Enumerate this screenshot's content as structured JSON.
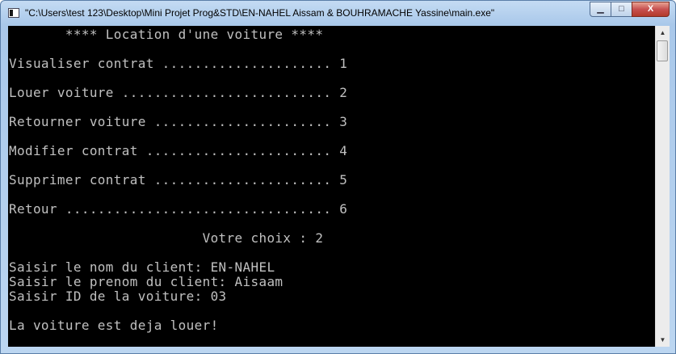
{
  "window": {
    "title": "\"C:\\Users\\test 123\\Desktop\\Mini Projet Prog&STD\\EN-NAHEL Aissam & BOUHRAMACHE Yassine\\main.exe\"",
    "minimize_label": "▁",
    "maximize_label": "□",
    "close_label": "X"
  },
  "console": {
    "lines": [
      "       **** Location d'une voiture ****",
      "",
      "Visualiser contrat ..................... 1",
      "",
      "Louer voiture .......................... 2",
      "",
      "Retourner voiture ...................... 3",
      "",
      "Modifier contrat ....................... 4",
      "",
      "Supprimer contrat ...................... 5",
      "",
      "Retour ................................. 6",
      "",
      "                        Votre choix : 2",
      "",
      "Saisir le nom du client: EN-NAHEL",
      "Saisir le prenom du client: Aisaam",
      "Saisir ID de la voiture: 03",
      "",
      "La voiture est deja louer!"
    ]
  },
  "scrollbar": {
    "up_arrow": "▲",
    "down_arrow": "▼"
  }
}
